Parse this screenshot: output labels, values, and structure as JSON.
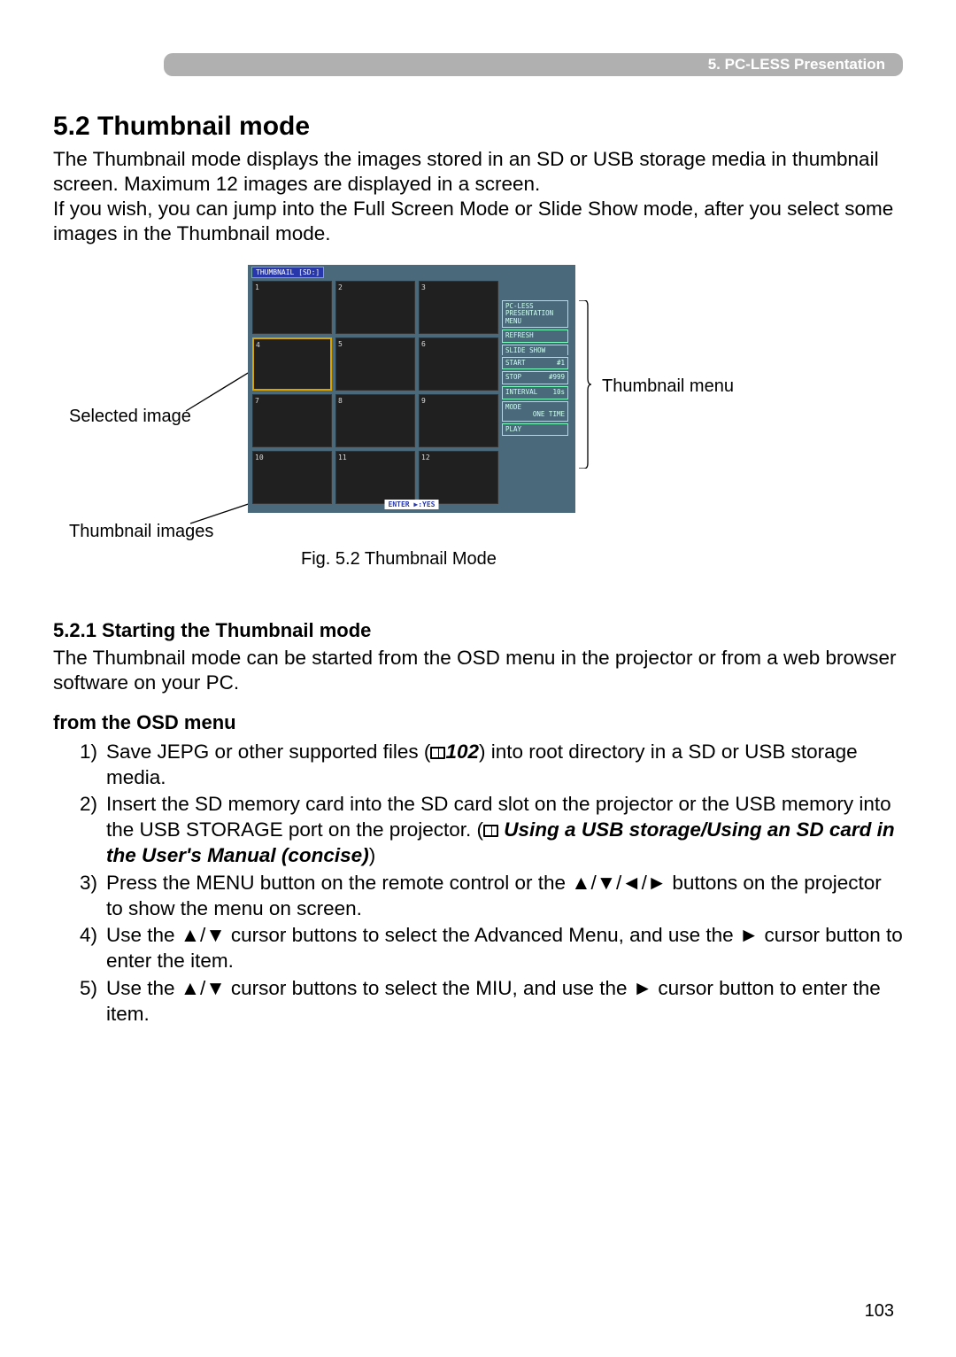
{
  "header": {
    "label": "5. PC-LESS Presentation"
  },
  "section": {
    "title": "5.2 Thumbnail mode",
    "intro": "The Thumbnail mode displays the images stored in an SD or USB storage media in thumbnail screen.  Maximum 12 images are displayed in a screen.\nIf you wish, you can jump into the Full Screen Mode or Slide Show mode, after you select some images in the Thumbnail mode."
  },
  "figure": {
    "caption": "Fig. 5.2 Thumbnail Mode",
    "labels": {
      "selected_image": "Selected image",
      "thumbnail_images": "Thumbnail images",
      "thumbnail_menu": "Thumbnail menu"
    },
    "screen": {
      "title": "THUMBNAIL [SD:]",
      "thumbs": [
        "1",
        "2",
        "3",
        "4",
        "5",
        "6",
        "7",
        "8",
        "9",
        "10",
        "11",
        "12"
      ],
      "selected_index": 3,
      "menu": {
        "header": "PC-LESS\nPRESENTATION\nMENU",
        "refresh": "REFRESH",
        "slide_show_label": "SLIDE SHOW",
        "rows": [
          {
            "k": "START",
            "v": "#1"
          },
          {
            "k": "STOP",
            "v": "#999"
          },
          {
            "k": "INTERVAL",
            "v": "10s"
          }
        ],
        "mode_label": "MODE",
        "mode_value": "ONE TIME",
        "play": "PLAY"
      },
      "hint": "ENTER ▶:YES"
    }
  },
  "subsection": {
    "title": "5.2.1 Starting the Thumbnail mode",
    "intro": "The Thumbnail mode can be started from the OSD menu in the projector or from a web browser software on your PC.",
    "from_osd_title": "from the OSD menu",
    "steps": {
      "s1a": "Save JEPG or other supported files (",
      "s1ref": "102",
      "s1b": ") into root directory in a SD or USB storage media.",
      "s2a": "Insert the SD memory card into the SD card slot on the projector or the USB memory into the USB STORAGE port on the projector. (",
      "s2ref": "Using a USB storage/Using an SD card in the User's Manual (concise)",
      "s2b": ")",
      "s3": "Press the MENU button on the remote control or the ▲/▼/◄/► buttons on the projector to show the menu on screen.",
      "s4": "Use the ▲/▼ cursor buttons to select the Advanced Menu, and use the ► cursor button to enter the item.",
      "s5": "Use the ▲/▼ cursor buttons to select the MIU, and use the ► cursor button to enter the item."
    }
  },
  "page_number": "103"
}
